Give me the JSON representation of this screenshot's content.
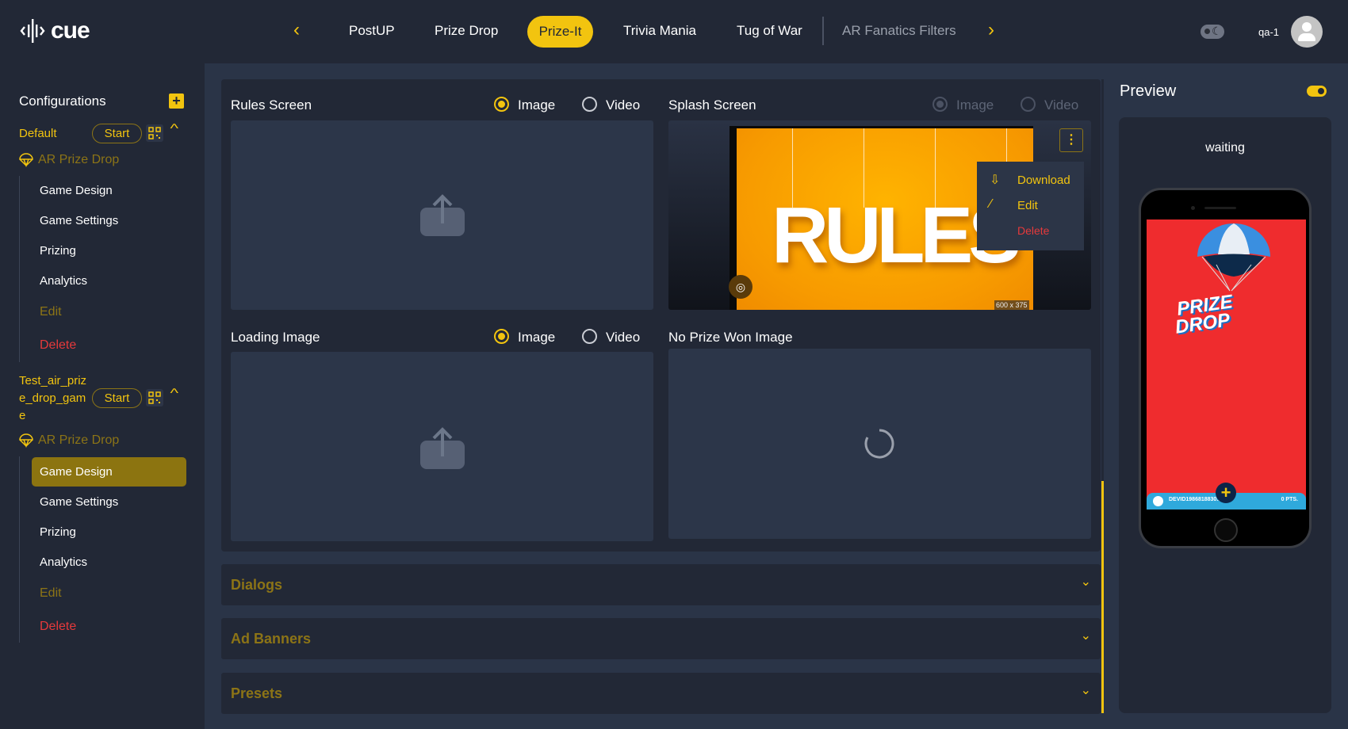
{
  "header": {
    "logo_text": "cue",
    "nav_prev": "‹",
    "nav_next": "›",
    "tabs": [
      {
        "label": "PostUP"
      },
      {
        "label": "Prize Drop"
      },
      {
        "label": "Prize-It",
        "active": true
      },
      {
        "label": "Trivia Mania"
      },
      {
        "label": "Tug of War"
      },
      {
        "label": "AR Fanatics Filters"
      }
    ],
    "user": "qa-1"
  },
  "sidebar": {
    "title": "Configurations",
    "configs": [
      {
        "name": "Default",
        "start_label": "Start",
        "game": "AR Prize Drop",
        "items": [
          "Game Design",
          "Game Settings",
          "Prizing",
          "Analytics",
          "Edit",
          "Delete"
        ]
      },
      {
        "name_lines": [
          "Test_air_priz",
          "e_drop_gam",
          "e"
        ],
        "start_label": "Start",
        "game": "AR Prize Drop",
        "items": [
          "Game Design",
          "Game Settings",
          "Prizing",
          "Analytics",
          "Edit",
          "Delete"
        ],
        "selected": "Game Design"
      }
    ]
  },
  "main": {
    "rules": {
      "title": "Rules Screen",
      "image": "Image",
      "video": "Video",
      "selected": "Image"
    },
    "splash": {
      "title": "Splash Screen",
      "image": "Image",
      "video": "Video",
      "selected": "Image",
      "image_text": "RULES",
      "dims": "600 x 375",
      "menu": {
        "download": "Download",
        "edit": "Edit",
        "delete": "Delete"
      }
    },
    "loading": {
      "title": "Loading Image",
      "image": "Image",
      "video": "Video",
      "selected": "Image"
    },
    "noprize": {
      "title": "No Prize Won Image"
    },
    "accordions": [
      "Dialogs",
      "Ad Banners",
      "Presets"
    ]
  },
  "preview": {
    "title": "Preview",
    "status": "waiting",
    "enabled": true,
    "game_title_1": "PRIZE",
    "game_title_2": "DROP",
    "device_id": "DEVID1986818830...",
    "points": "0 PTS."
  },
  "colors": {
    "accent": "#f2c40f",
    "bg": "#2a3447",
    "panel": "#222836",
    "danger": "#e6393b"
  }
}
